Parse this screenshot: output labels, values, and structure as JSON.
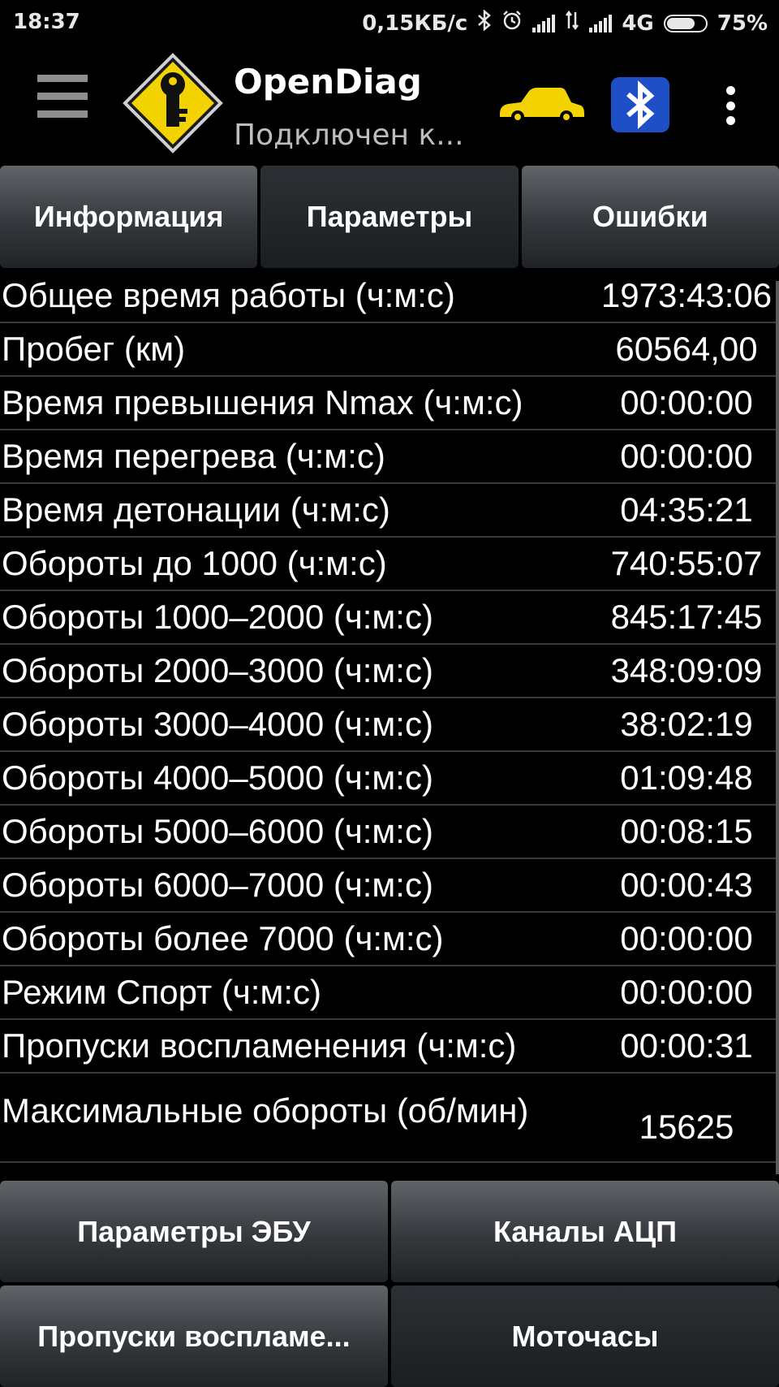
{
  "status_bar": {
    "time": "18:37",
    "network_speed": "0,15КБ/с",
    "network_type": "4G",
    "battery": "75%",
    "battery_level": 0.75
  },
  "action_bar": {
    "title": "OpenDiag",
    "subtitle": "Подключен к...",
    "icons": [
      "menu-icon",
      "app-logo-key-icon",
      "car-icon",
      "bluetooth-elm327-icon",
      "overflow-menu-icon"
    ],
    "accent_color": "#F2D300"
  },
  "tabs": [
    {
      "label": "Информация",
      "active": false
    },
    {
      "label": "Параметры",
      "active": true
    },
    {
      "label": "Ошибки",
      "active": false
    }
  ],
  "parameters": [
    {
      "label": "Общее время работы (ч:м:с)",
      "value": "1973:43:06"
    },
    {
      "label": "Пробег (км)",
      "value": "60564,00"
    },
    {
      "label": "Время превышения Nmax (ч:м:с)",
      "value": "00:00:00"
    },
    {
      "label": "Время перегрева (ч:м:с)",
      "value": "00:00:00"
    },
    {
      "label": "Время детонации (ч:м:с)",
      "value": "04:35:21"
    },
    {
      "label": "Обороты до 1000 (ч:м:с)",
      "value": "740:55:07"
    },
    {
      "label": "Обороты 1000–2000 (ч:м:с)",
      "value": "845:17:45"
    },
    {
      "label": "Обороты 2000–3000 (ч:м:с)",
      "value": "348:09:09"
    },
    {
      "label": "Обороты 3000–4000 (ч:м:с)",
      "value": "38:02:19"
    },
    {
      "label": "Обороты 4000–5000 (ч:м:с)",
      "value": "01:09:48"
    },
    {
      "label": "Обороты 5000–6000 (ч:м:с)",
      "value": "00:08:15"
    },
    {
      "label": "Обороты 6000–7000 (ч:м:с)",
      "value": "00:00:43"
    },
    {
      "label": "Обороты более 7000 (ч:м:с)",
      "value": "00:00:00"
    },
    {
      "label": "Режим Спорт (ч:м:с)",
      "value": "00:00:00"
    },
    {
      "label": "Пропуски воспламенения (ч:м:с)",
      "value": "00:00:31"
    },
    {
      "label": "Максимальные обороты (об/мин)",
      "value": "15625"
    }
  ],
  "bottom_buttons": [
    {
      "label": "Параметры ЭБУ",
      "active": false
    },
    {
      "label": "Каналы АЦП",
      "active": false
    },
    {
      "label": "Пропуски воспламе...",
      "active": false
    },
    {
      "label": "Моточасы",
      "active": true
    }
  ]
}
